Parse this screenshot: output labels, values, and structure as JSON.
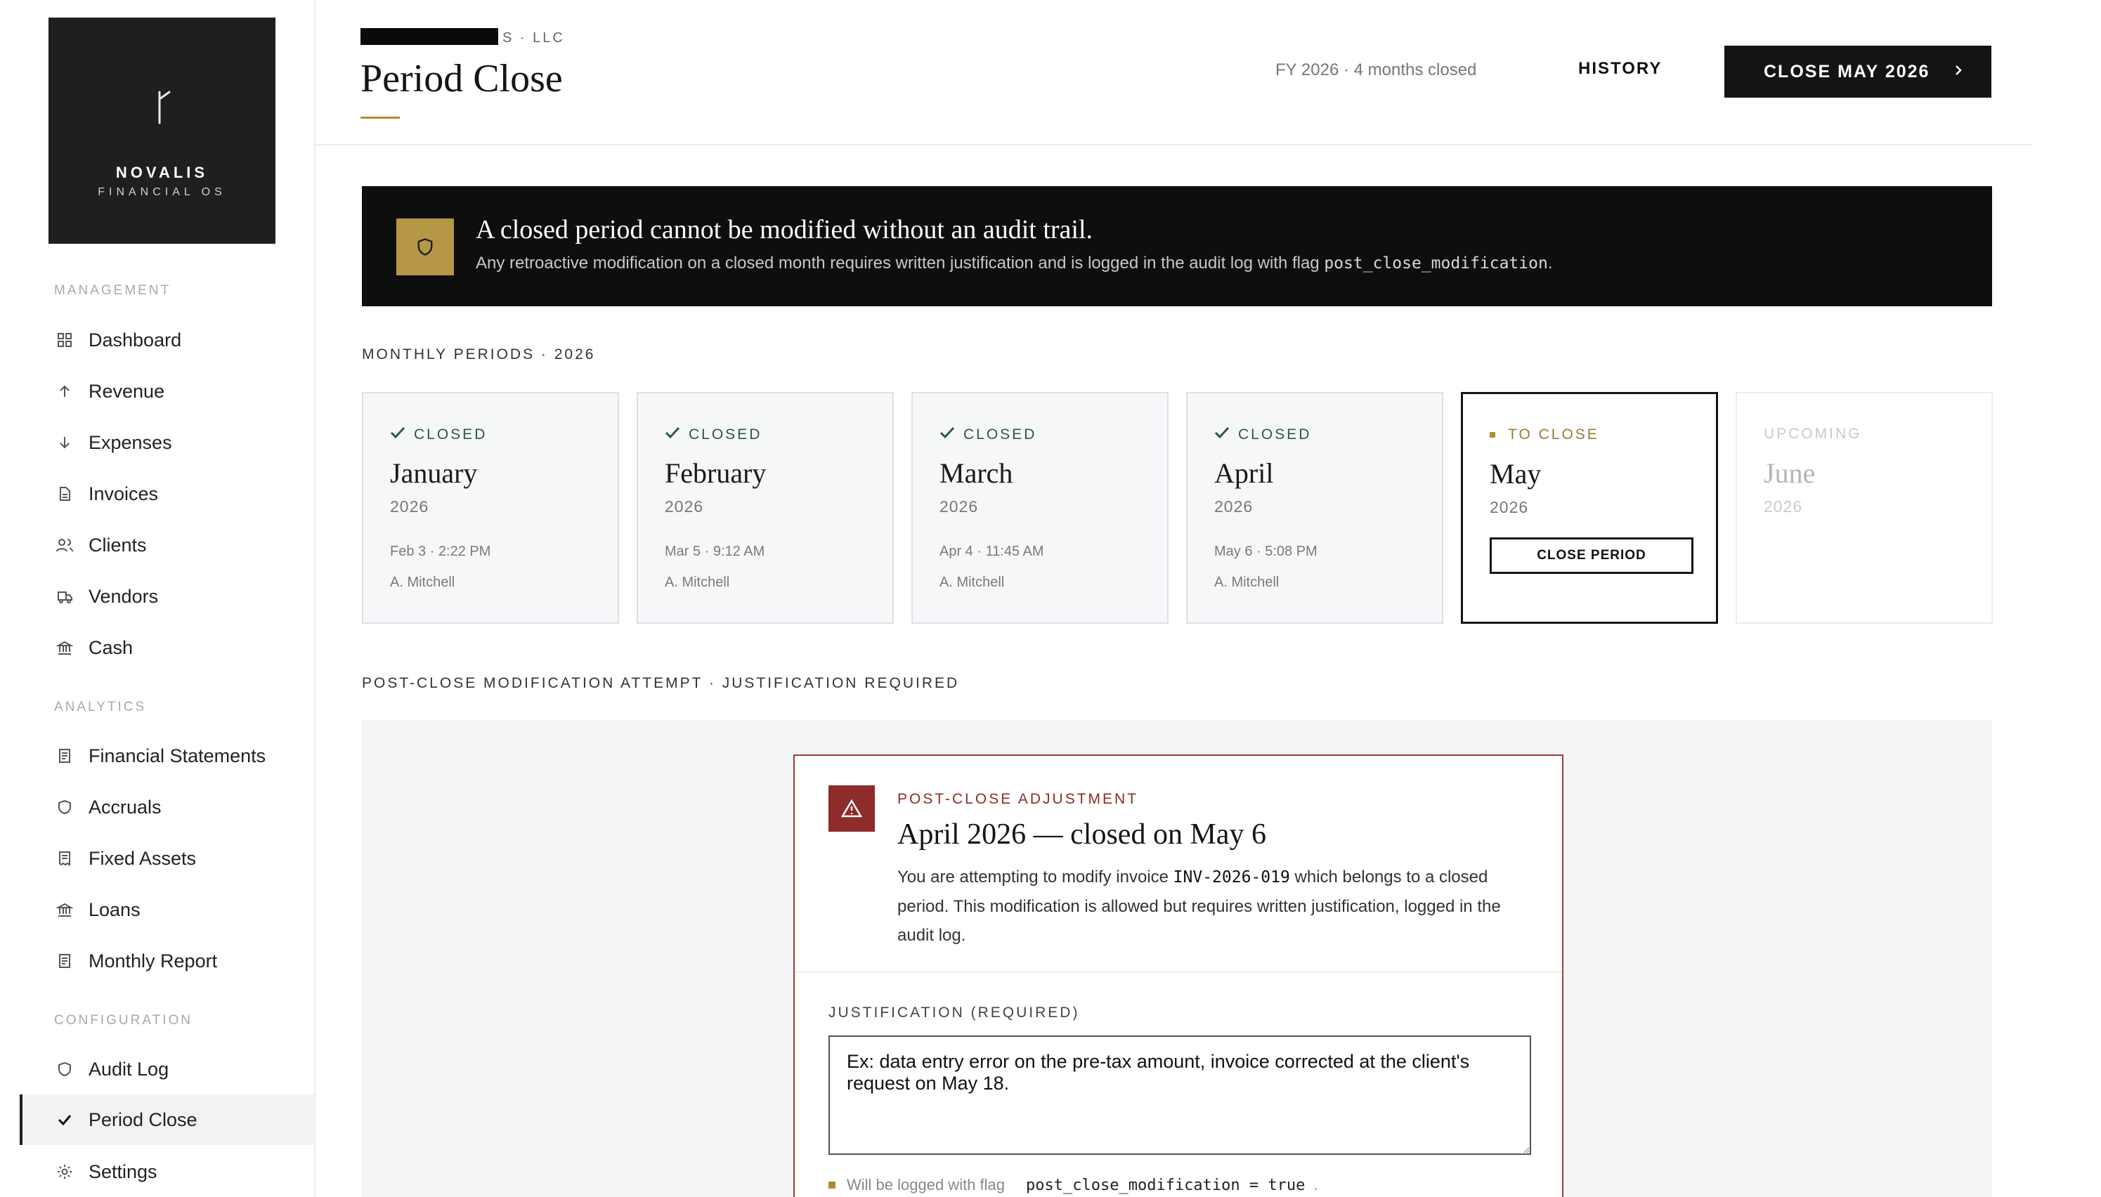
{
  "brand": {
    "name": "NOVALIS",
    "subtitle": "FINANCIAL OS"
  },
  "sidebar": {
    "sections": [
      {
        "title": "MANAGEMENT"
      },
      {
        "title": "ANALYTICS"
      },
      {
        "title": "CONFIGURATION"
      }
    ],
    "items": [
      {
        "label": "Dashboard",
        "icon": "grid-icon"
      },
      {
        "label": "Revenue",
        "icon": "arrow-up-icon"
      },
      {
        "label": "Expenses",
        "icon": "arrow-down-icon"
      },
      {
        "label": "Invoices",
        "icon": "document-icon"
      },
      {
        "label": "Clients",
        "icon": "users-icon"
      },
      {
        "label": "Vendors",
        "icon": "truck-icon"
      },
      {
        "label": "Cash",
        "icon": "bank-icon"
      },
      {
        "label": "Financial Statements",
        "icon": "report-icon"
      },
      {
        "label": "Accruals",
        "icon": "shield-icon"
      },
      {
        "label": "Fixed Assets",
        "icon": "receipt-icon"
      },
      {
        "label": "Loans",
        "icon": "bank-icon"
      },
      {
        "label": "Monthly Report",
        "icon": "report-icon"
      },
      {
        "label": "Audit Log",
        "icon": "shield-icon"
      },
      {
        "label": "Period Close",
        "icon": "check-icon",
        "active": true
      },
      {
        "label": "Settings",
        "icon": "gear-icon"
      }
    ]
  },
  "header": {
    "company_suffix": "S · LLC",
    "title": "Period Close",
    "fy_status": "FY 2026 · 4 months closed",
    "history_label": "HISTORY",
    "close_label": "CLOSE MAY 2026"
  },
  "banner": {
    "title": "A closed period cannot be modified without an audit trail.",
    "text": "Any retroactive modification on a closed month requires written justification and is logged in the audit log with flag ",
    "flag": "post_close_modification",
    "text_end": "."
  },
  "periods": {
    "section_label": "MONTHLY PERIODS · 2026",
    "cards": [
      {
        "status": "CLOSED",
        "month": "January",
        "year": "2026",
        "closed_at": "Feb 3 · 2:22 PM",
        "closed_by": "A. Mitchell"
      },
      {
        "status": "CLOSED",
        "month": "February",
        "year": "2026",
        "closed_at": "Mar 5 · 9:12 AM",
        "closed_by": "A. Mitchell"
      },
      {
        "status": "CLOSED",
        "month": "March",
        "year": "2026",
        "closed_at": "Apr 4 · 11:45 AM",
        "closed_by": "A. Mitchell"
      },
      {
        "status": "CLOSED",
        "month": "April",
        "year": "2026",
        "closed_at": "May 6 · 5:08 PM",
        "closed_by": "A. Mitchell"
      },
      {
        "status": "TO CLOSE",
        "month": "May",
        "year": "2026",
        "button": "CLOSE PERIOD"
      },
      {
        "status": "UPCOMING",
        "month": "June",
        "year": "2026"
      }
    ]
  },
  "modification": {
    "section_label": "POST-CLOSE MODIFICATION ATTEMPT · JUSTIFICATION REQUIRED",
    "kicker": "POST-CLOSE ADJUSTMENT",
    "title": "April 2026 — closed on May 6",
    "body_pre": "You are attempting to modify invoice ",
    "invoice": "INV-2026-019",
    "body_post": " which belongs to a closed period. This modification is allowed but requires written justification, logged in the audit log.",
    "justification_label": "JUSTIFICATION (REQUIRED)",
    "justification_placeholder": "Ex: data entry error on the pre-tax amount, invoice corrected at the client's request on May 18.",
    "log_note": "Will be logged with flag",
    "log_flag": "post_close_modification = true",
    "log_note_end": "."
  },
  "colors": {
    "accent_gold": "#b08a3c",
    "closed_green": "#2a5a3a",
    "danger_red": "#8e2b2b",
    "dark": "#141414"
  }
}
